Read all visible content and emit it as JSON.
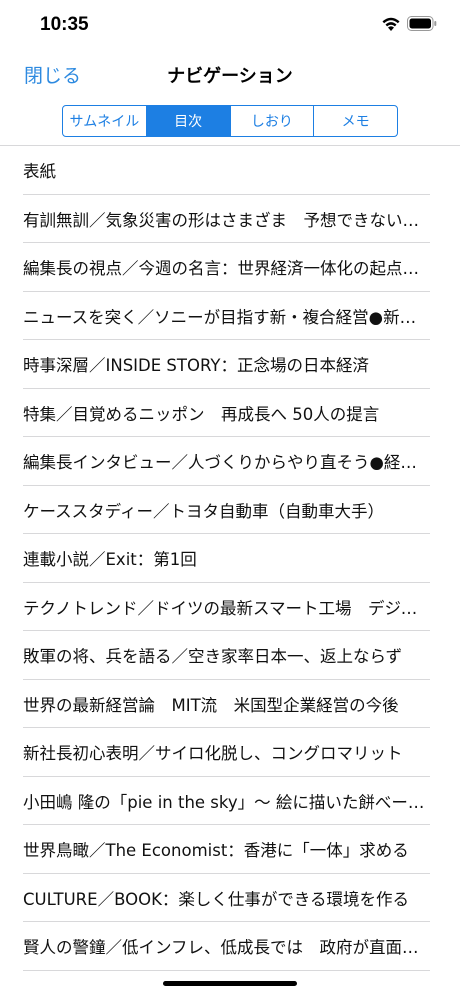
{
  "status_bar": {
    "time": "10:35",
    "wifi_icon": "wifi-icon",
    "battery_icon": "battery-icon"
  },
  "nav": {
    "close_label": "閉じる",
    "title": "ナビゲーション"
  },
  "segments": [
    {
      "label": "サムネイル",
      "active": false
    },
    {
      "label": "目次",
      "active": true
    },
    {
      "label": "しおり",
      "active": false
    },
    {
      "label": "メモ",
      "active": false
    }
  ],
  "toc": [
    "表紙",
    "有訓無訓／気象災害の形はさまざま　予想できない事態を想定し最悪の事態に備えよ",
    "編集長の視点／今週の名言：世界経済一体化の起点となる",
    "ニュースを突く／ソニーが目指す新・複合経営●新たな成長",
    "時事深層／INSIDE STORY：正念場の日本経済",
    "特集／目覚めるニッポン　再成長へ 50人の提言",
    "編集長インタビュー／人づくりからやり直そう●経営者",
    "ケーススタディー／トヨタ自動車（自動車大手）",
    "連載小説／Exit：第1回",
    "テクノトレンド／ドイツの最新スマート工場　デジタル化",
    "敗軍の将、兵を語る／空き家率日本一、返上ならず",
    "世界の最新経営論　MIT流　米国型企業経営の今後",
    "新社長初心表明／サイロ化脱し、コングロマリット",
    "小田嶋 隆の「pie in the sky」〜 絵に描いた餅べーカリー",
    "世界鳥瞰／The Economist：香港に「一体」求める",
    "CULTURE／BOOK：楽しく仕事ができる環境を作る",
    "賢人の警鐘／低インフレ、低成長では　政府が直面する"
  ],
  "colors": {
    "accent": "#1d7fe3",
    "close_link": "#2d8ae0"
  }
}
